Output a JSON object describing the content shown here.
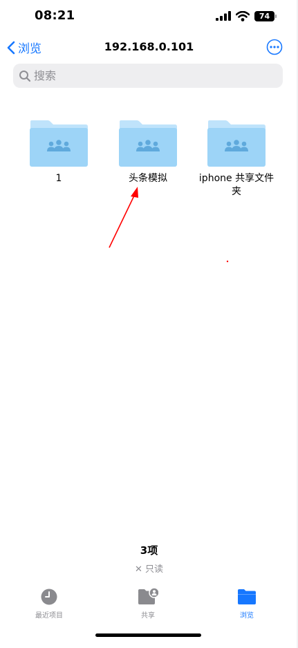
{
  "status_bar": {
    "time": "08:21",
    "battery": "74"
  },
  "nav": {
    "back_label": "浏览",
    "title": "192.168.0.101"
  },
  "search": {
    "placeholder": "搜索"
  },
  "folders": [
    {
      "name": "1"
    },
    {
      "name": "头条模拟"
    },
    {
      "name": "iphone 共享文件夹"
    }
  ],
  "summary": {
    "count": "3项",
    "readonly": "只读"
  },
  "tabs": [
    {
      "label": "最近项目",
      "icon": "clock-icon"
    },
    {
      "label": "共享",
      "icon": "shared-folder-icon"
    },
    {
      "label": "浏览",
      "icon": "folder-icon",
      "active": true
    }
  ],
  "colors": {
    "accent": "#1677ff",
    "folder_body": "#9dd4f7",
    "folder_tab": "#bfe3fb",
    "folder_glyph": "#5fa9dc",
    "annotation_arrow": "#ff0000",
    "secondary_text": "#8e8e93"
  }
}
